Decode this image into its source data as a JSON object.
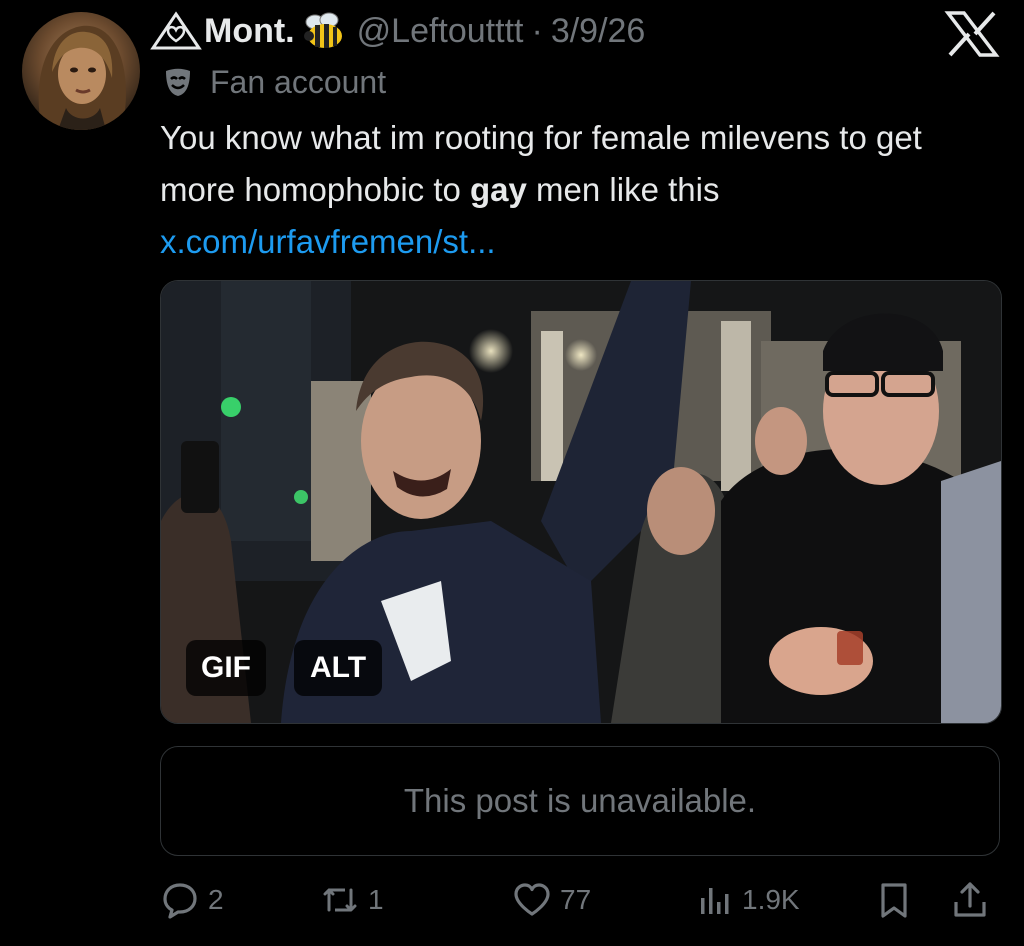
{
  "post": {
    "author_name": "Mont.",
    "author_handle": "@Leftoutttt",
    "separator": "·",
    "date": "3/9/26",
    "account_label": "Fan account",
    "text_before": "You know what im rooting for female milevens to get more homophobic to ",
    "text_bold": "gay",
    "text_after": " men like this",
    "link": "x.com/urfavfremen/st...",
    "media_badges": {
      "gif": "GIF",
      "alt": "ALT"
    },
    "quoted_unavailable": "This post is unavailable."
  },
  "actions": {
    "replies": "2",
    "reposts": "1",
    "likes": "77",
    "views": "1.9K"
  },
  "icons": {
    "header": [
      "triangle-heart-icon",
      "bee-icon",
      "x-logo-icon",
      "mask-icon"
    ],
    "actions": [
      "reply-icon",
      "repost-icon",
      "like-icon",
      "views-icon",
      "bookmark-icon",
      "share-icon"
    ]
  },
  "colors": {
    "background": "#000000",
    "text": "#e7e9ea",
    "secondary": "#71767b",
    "link": "#1d9bf0",
    "border": "#2f3336"
  }
}
